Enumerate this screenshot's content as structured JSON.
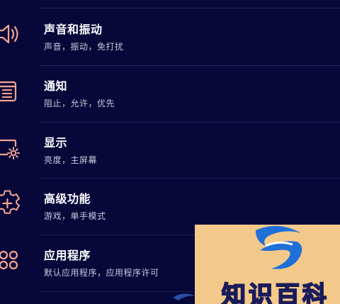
{
  "settings": {
    "items": [
      {
        "title": "声音和振动",
        "subtitle": "声音，振动，免打扰",
        "icon": "speaker-icon"
      },
      {
        "title": "通知",
        "subtitle": "阻止，允许，优先",
        "icon": "notification-list-icon"
      },
      {
        "title": "显示",
        "subtitle": "亮度，主屏幕",
        "icon": "display-settings-icon"
      },
      {
        "title": "高级功能",
        "subtitle": "游戏，单手模式",
        "icon": "advanced-features-icon"
      },
      {
        "title": "应用程序",
        "subtitle": "默认应用程序，应用程序许可",
        "icon": "apps-grid-icon"
      }
    ]
  },
  "watermark": {
    "text": "知识百科"
  },
  "colors": {
    "background": "#07073a",
    "icon_accent": "#f2a58e",
    "divider": "#1d2257",
    "watermark_bg": "#f2c98a",
    "logo_blue": "#1e6fd8"
  }
}
